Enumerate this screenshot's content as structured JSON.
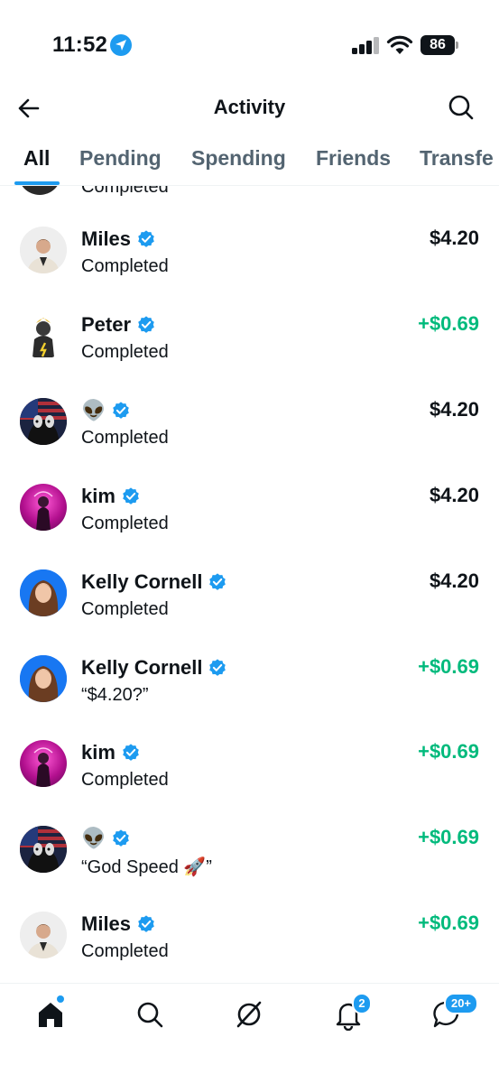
{
  "status_bar": {
    "time": "11:52",
    "battery": "86"
  },
  "header": {
    "title": "Activity"
  },
  "tabs": [
    {
      "label": "All",
      "active": true
    },
    {
      "label": "Pending",
      "active": false
    },
    {
      "label": "Spending",
      "active": false
    },
    {
      "label": "Friends",
      "active": false
    },
    {
      "label": "Transfe",
      "active": false
    }
  ],
  "partial_row": {
    "status": "Completed"
  },
  "transactions": [
    {
      "name": "Miles",
      "status": "Completed",
      "amount": "$4.20",
      "credit": false
    },
    {
      "name": "Peter",
      "status": "Completed",
      "amount": "+$0.69",
      "credit": true
    },
    {
      "name": "👽",
      "status": "Completed",
      "amount": "$4.20",
      "credit": false
    },
    {
      "name": "kim",
      "status": "Completed",
      "amount": "$4.20",
      "credit": false
    },
    {
      "name": "Kelly Cornell",
      "status": "Completed",
      "amount": "$4.20",
      "credit": false
    },
    {
      "name": "Kelly Cornell",
      "status": "“$4.20?”",
      "amount": "+$0.69",
      "credit": true
    },
    {
      "name": "kim",
      "status": "Completed",
      "amount": "+$0.69",
      "credit": true
    },
    {
      "name": "👽",
      "status": "“God Speed 🚀”",
      "amount": "+$0.69",
      "credit": true
    },
    {
      "name": "Miles",
      "status": "Completed",
      "amount": "+$0.69",
      "credit": true
    }
  ],
  "bottom_nav": {
    "items": [
      "home-icon",
      "search-icon",
      "grok-icon",
      "notifications-icon",
      "messages-icon"
    ],
    "notifications_badge": "2",
    "messages_badge": "20+"
  },
  "colors": {
    "accent": "#1d9bf0",
    "credit": "#00ba7c",
    "text": "#0f1419",
    "muted": "#536471"
  }
}
